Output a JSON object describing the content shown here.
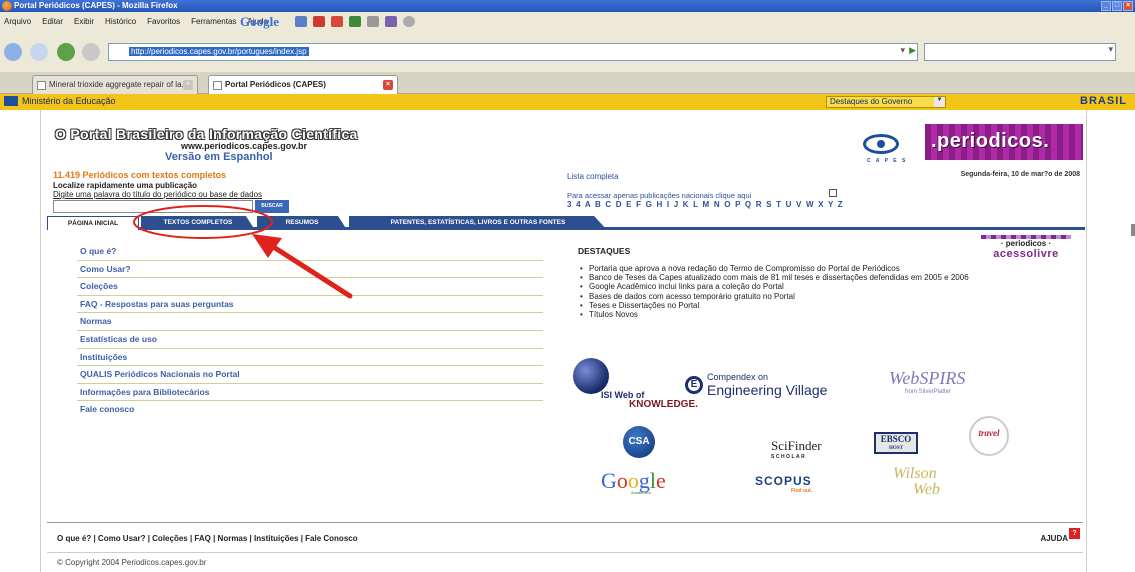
{
  "window": {
    "title": "Portal Periódicos (CAPES) - Mozilla Firefox"
  },
  "menubar": {
    "items": [
      "Arquivo",
      "Editar",
      "Exibir",
      "Histórico",
      "Favoritos",
      "Ferramentas",
      "Ajuda"
    ],
    "google_label": "Google"
  },
  "navbar": {
    "url": "http://periodicos.capes.gov.br/portugues/index.jsp",
    "search_value": ""
  },
  "tabs": [
    {
      "label": "Mineral trioxide aggregate repair of la..."
    },
    {
      "label": "Portal Periódicos (CAPES)"
    }
  ],
  "govbar": {
    "ministry": "Ministério da Educação",
    "select_value": "Destaques do Governo",
    "brasil": "BRASIL"
  },
  "header": {
    "title": "O Portal Brasileiro da Informação Científica",
    "url": "www.periodicos.capes.gov.br",
    "spanish_link": "Versão em Espanhol",
    "count": "11.419 Periódicos com textos completos",
    "search_label1": "Localize rapidamente uma publicação",
    "search_label2": "Digite uma palavra do título do periódico ou base de dados",
    "search_button": "BUSCAR",
    "lista": "Lista completa",
    "nacional": "Para acessar apenas publicações nacionais clique aqui",
    "alphabet": "3 4 A B C D E F G H I J K L M N O P Q R S T U V W X Y Z",
    "date": "Segunda-feira, 10 de mar?o de 2008",
    "capes": "C A P E S",
    "periodicos": ".periodicos."
  },
  "section_tabs": {
    "inicial": "PÁGINA INICIAL",
    "completos": "TEXTOS COMPLETOS",
    "resumos": "RESUMOS",
    "patentes": "PATENTES, ESTATÍSTICAS, LIVROS E OUTRAS FONTES"
  },
  "left_menu": [
    "O que é?",
    "Como Usar?",
    "Coleções",
    "FAQ - Respostas para suas perguntas",
    "Normas",
    "Estatísticas de uso",
    "Instituições",
    "QUALIS Periódicos Nacionais no Portal",
    "Informações para Bibliotecários",
    "Fale conosco"
  ],
  "destaques": {
    "title": "DESTAQUES",
    "items": [
      "Portaria que aprova a nova redação do Termo de Compromisso do Portal de Periódicos",
      "Banco de Teses da Capes atualizado com mais de 81 mil teses e dissertações defendidas em 2005 e 2006",
      "Google Acadêmico inclui links para a coleção do Portal",
      "Bases de dados com acesso temporário gratuito no Portal",
      "Teses e Dissertações no Portal",
      "Títulos Novos"
    ],
    "acesso_line1": "· periodicos ·",
    "acesso_line2": "acessolivre"
  },
  "logos": {
    "isi": "ISI Web of",
    "isi_knowledge": "KNOWLEDGE.",
    "compendex": "Compendex on",
    "engineering_village": "Engineering Village",
    "webspirs": "WebSPIRS",
    "webspirs_sub": "from SilverPlatter",
    "csa": "CSA",
    "scifinder": "SciFinder",
    "scifinder_sub": "SCHOLAR",
    "ebsco": "EBSCO",
    "ebsco_sub": "HOST",
    "travel": "travel",
    "google": "Google",
    "google_sub": "Acadêmico",
    "scopus": "SCOPUS",
    "scopus_sub": "Find out.",
    "wilson": "Wilson",
    "wilson_web": "Web"
  },
  "footer": {
    "links": "O que é? | Como Usar? | Coleções | FAQ | Normas | Instituições | Fale Conosco",
    "ajuda": "AJUDA",
    "copyright": "© Copyright 2004 Periodicos.capes.gov.br"
  },
  "colors": {
    "accent": "#2d4f8f",
    "annotation": "#e0231a",
    "gov_yellow": "#f2c517"
  }
}
